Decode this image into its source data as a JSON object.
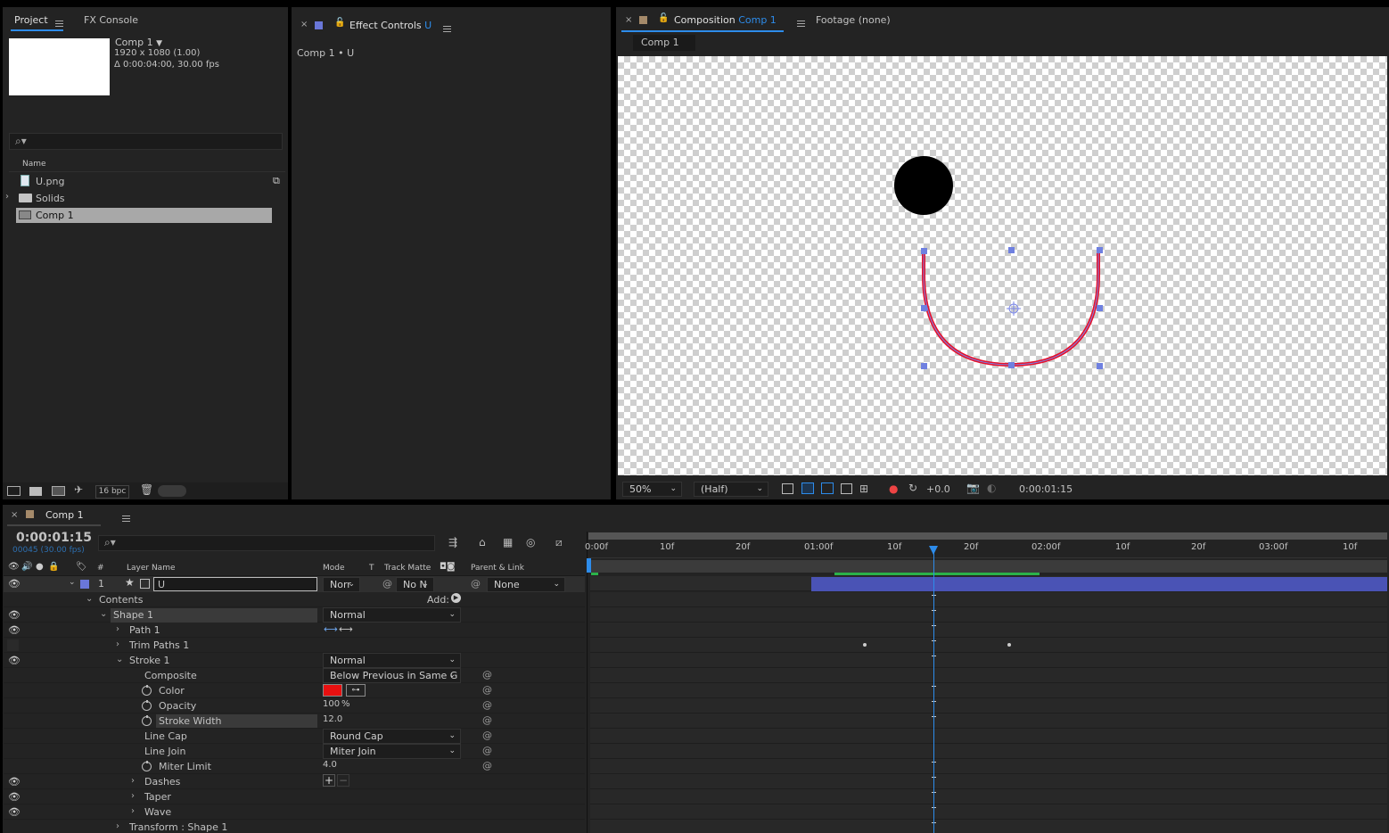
{
  "project": {
    "tabs": [
      "Project",
      "FX Console"
    ],
    "comp_name": "Comp 1",
    "comp_size": "1920 x 1080 (1.00)",
    "comp_duration": "Δ 0:00:04:00, 30.00 fps",
    "col_name": "Name",
    "items": [
      "U.png",
      "Solids",
      "Comp 1"
    ],
    "bpc": "16 bpc"
  },
  "effect_controls": {
    "tab_label": "Effect Controls",
    "tab_layer": "U",
    "breadcrumb": "Comp 1 • U"
  },
  "composition": {
    "tab_label": "Composition",
    "tab_comp": "Comp 1",
    "footage_tab": "Footage  (none)",
    "subtab": "Comp 1",
    "zoom": "50%",
    "resolution": "(Half)",
    "exposure": "+0.0",
    "timecode": "0:00:01:15"
  },
  "timeline": {
    "tab": "Comp 1",
    "timecode": "0:00:01:15",
    "frame_info": "00045 (30.00 fps)",
    "col_labels": {
      "hash": "#",
      "layer_name": "Layer Name",
      "mode": "Mode",
      "t": "T",
      "track_matte": "Track Matte",
      "parent": "Parent & Link"
    },
    "layer": {
      "number": "1",
      "name": "U",
      "mode": "Norr",
      "track_matte": "No N",
      "parent": "None"
    },
    "ruler": [
      "0:00f",
      "10f",
      "20f",
      "01:00f",
      "10f",
      "20f",
      "02:00f",
      "10f",
      "20f",
      "03:00f",
      "10f"
    ],
    "props": {
      "contents": "Contents",
      "add": "Add:",
      "shape1": "Shape 1",
      "shape1_mode": "Normal",
      "path1": "Path 1",
      "trim": "Trim Paths 1",
      "stroke1": "Stroke 1",
      "stroke1_mode": "Normal",
      "composite": "Composite",
      "composite_val": "Below Previous in Same G",
      "color": "Color",
      "opacity": "Opacity",
      "opacity_val": "100",
      "opacity_unit": "%",
      "stroke_width": "Stroke Width",
      "stroke_width_val": "12.0",
      "line_cap": "Line Cap",
      "line_cap_val": "Round Cap",
      "line_join": "Line Join",
      "line_join_val": "Miter Join",
      "miter": "Miter Limit",
      "miter_val": "4.0",
      "dashes": "Dashes",
      "taper": "Taper",
      "wave": "Wave",
      "transform": "Transform : Shape 1"
    }
  },
  "colors": {
    "accent": "#2d8ceb",
    "stroke": "#e8102a",
    "layer_bar": "#4a53b5",
    "work_area": "#2bb24a"
  }
}
